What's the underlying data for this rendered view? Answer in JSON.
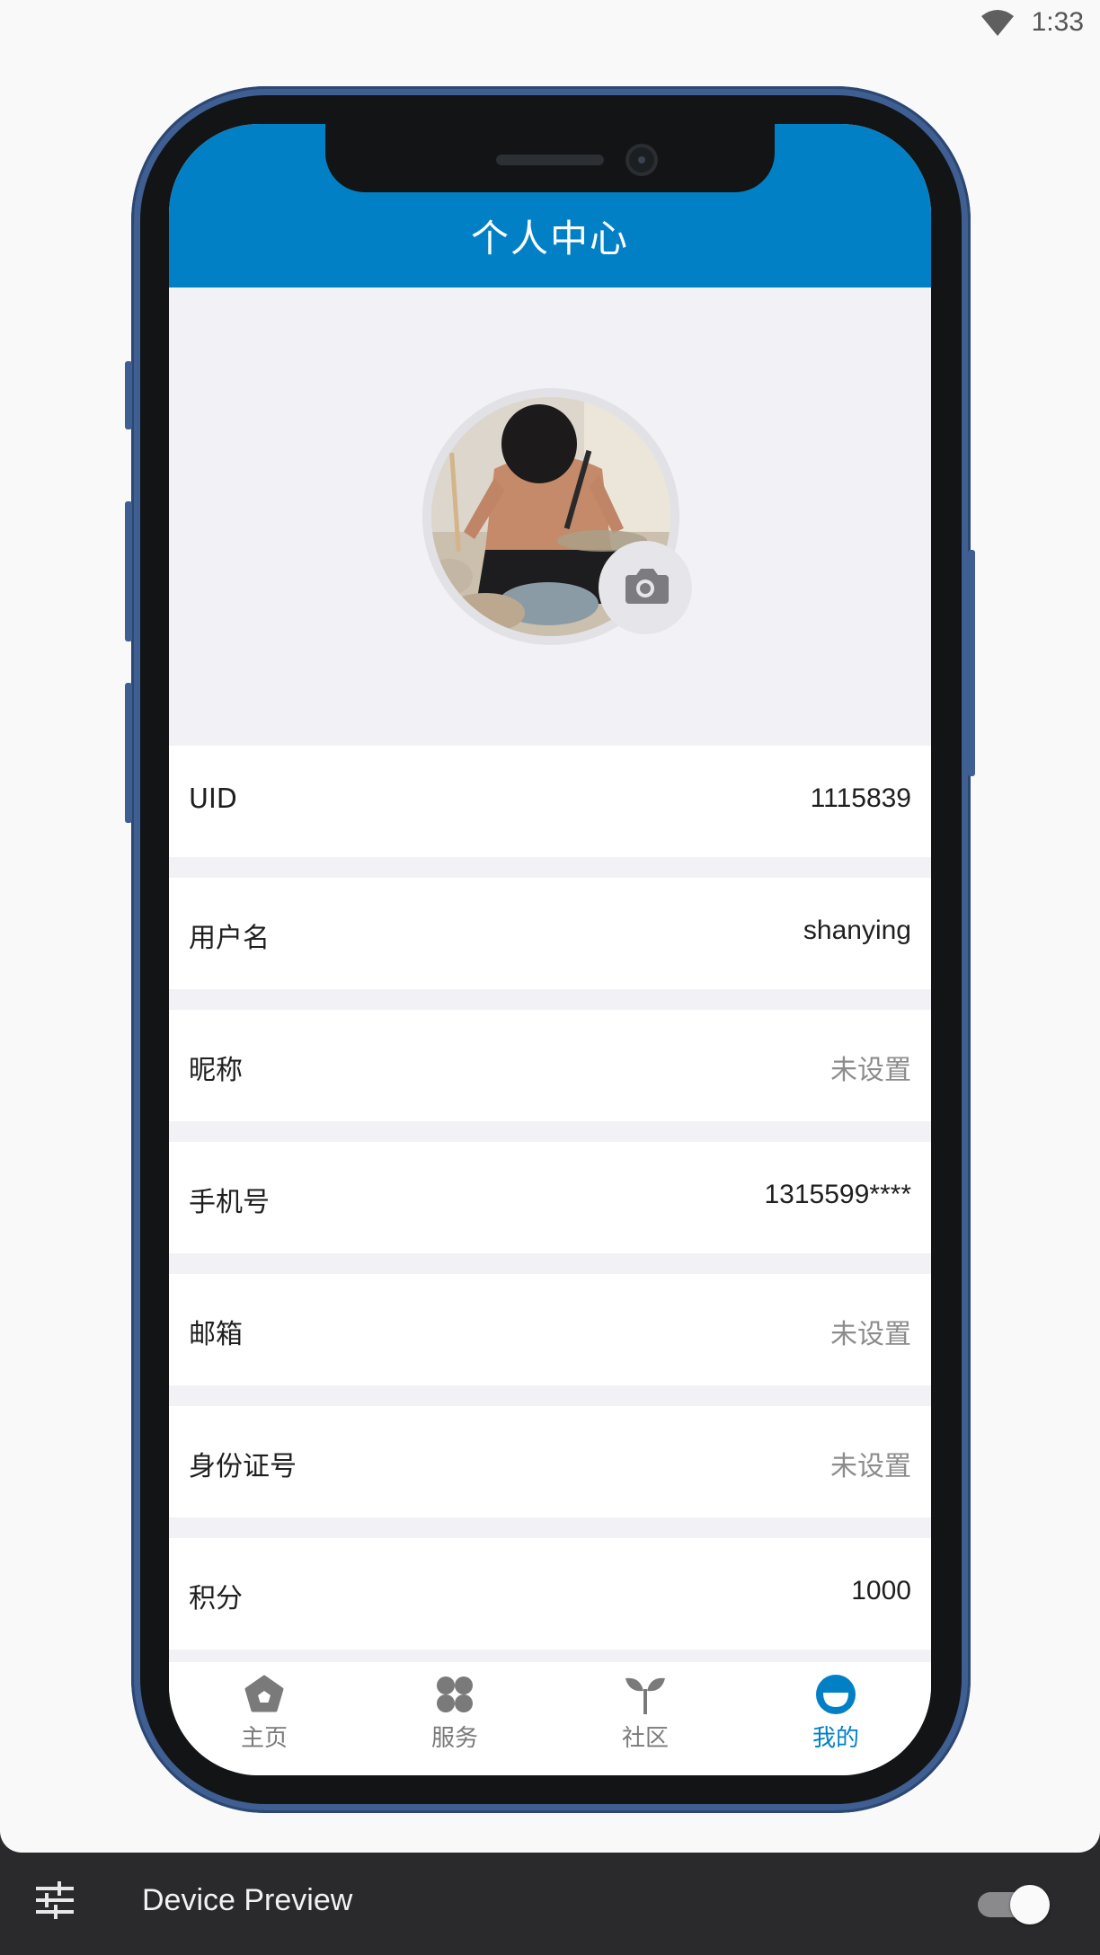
{
  "status_bar": {
    "time": "1:33",
    "wifi_icon": "wifi-icon"
  },
  "app_bar": {
    "title": "个人中心",
    "color": "#0280c6"
  },
  "profile": {
    "avatar": "avatar-photo",
    "camera_icon": "camera-icon"
  },
  "rows": [
    {
      "label": "UID",
      "value": "1115839",
      "unset": false
    },
    {
      "label": "用户名",
      "value": "shanying",
      "unset": false
    },
    {
      "label": "昵称",
      "value": "未设置",
      "unset": true
    },
    {
      "label": "手机号",
      "value": "1315599****",
      "unset": false
    },
    {
      "label": "邮箱",
      "value": "未设置",
      "unset": true
    },
    {
      "label": "身份证号",
      "value": "未设置",
      "unset": true
    },
    {
      "label": "积分",
      "value": "1000",
      "unset": false
    }
  ],
  "tabs": [
    {
      "label": "主页",
      "icon": "home-pentagon-icon",
      "active": false
    },
    {
      "label": "服务",
      "icon": "grid-services-icon",
      "active": false
    },
    {
      "label": "社区",
      "icon": "sprout-icon",
      "active": false
    },
    {
      "label": "我的",
      "icon": "profile-face-icon",
      "active": true
    }
  ],
  "bottom_bar": {
    "title": "Device Preview",
    "settings_icon": "tune-icon",
    "toggle_on": true
  }
}
